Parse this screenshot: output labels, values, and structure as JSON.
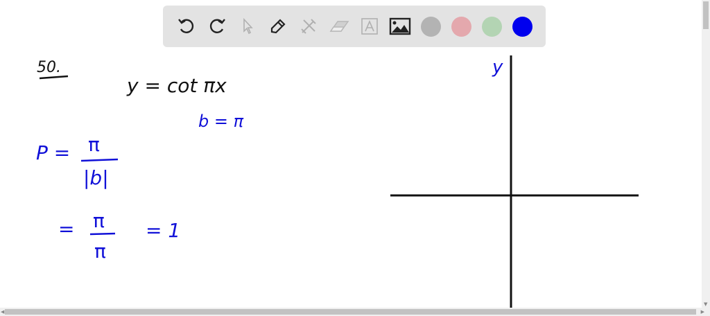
{
  "toolbar": {
    "tools": [
      "undo-icon",
      "redo-icon",
      "select-icon",
      "pen-icon",
      "tools-icon",
      "eraser-icon",
      "text-icon",
      "image-icon"
    ],
    "colors": [
      "#b3b3b3",
      "#e4a8ad",
      "#b3d4b3",
      "#0000ee"
    ],
    "active_color": "#0000ee"
  },
  "board": {
    "problem_number": "50.",
    "equation": "y = cot πx",
    "b_value": "b = π",
    "period_lhs": "P =",
    "period_num": "π",
    "period_den": "|b|",
    "eq_sign": "=",
    "step_num": "π",
    "step_den": "π",
    "result": "= 1",
    "y_axis_label": "y",
    "ink_black": "#111111",
    "ink_blue": "#1010d8"
  }
}
